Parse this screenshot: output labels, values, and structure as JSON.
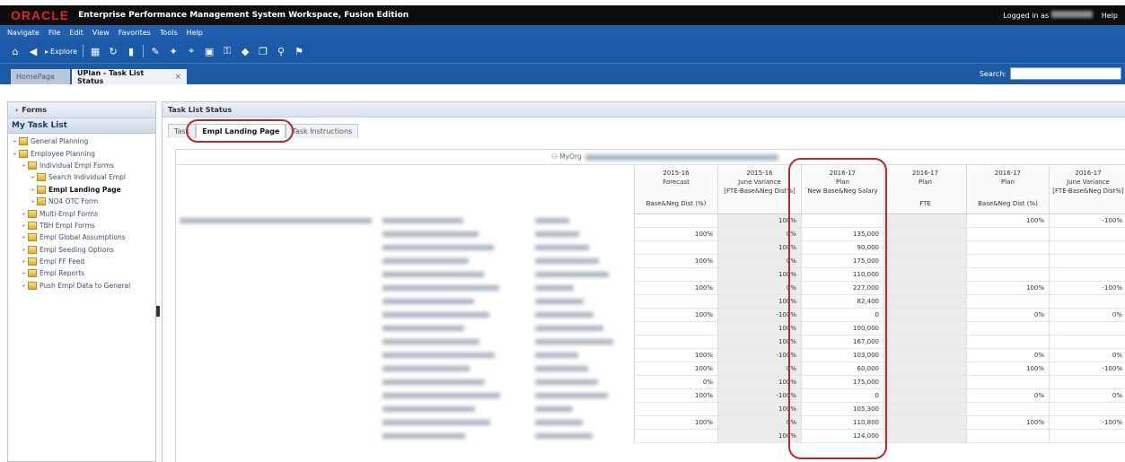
{
  "titlebar": {
    "logo": "ORACLE",
    "title": "Enterprise Performance Management System Workspace, Fusion Edition",
    "logged_in_label": "Logged in as",
    "help_label": "Help"
  },
  "menubar": {
    "items": [
      "Navigate",
      "File",
      "Edit",
      "View",
      "Favorites",
      "Tools",
      "Help"
    ]
  },
  "toolbar": {
    "explore_label": "Explore"
  },
  "tabs": {
    "home_label": "HomePage",
    "active_label": "UPlan - Task List Status",
    "close_glyph": "×"
  },
  "search": {
    "label": "Search:",
    "value": ""
  },
  "leftpanel": {
    "forms_label": "Forms",
    "task_list_label": "My Task List",
    "tree": [
      {
        "label": "General Planning",
        "indent": 0,
        "bold": false
      },
      {
        "label": "Employee Planning",
        "indent": 0,
        "bold": false
      },
      {
        "label": "Individual Empl Forms",
        "indent": 1,
        "bold": false
      },
      {
        "label": "Search Individual Empl",
        "indent": 2,
        "bold": false
      },
      {
        "label": "Empl Landing Page",
        "indent": 2,
        "bold": true
      },
      {
        "label": "NO4 OTC Form",
        "indent": 2,
        "bold": false
      },
      {
        "label": "Multi-Empl Forms",
        "indent": 1,
        "bold": false
      },
      {
        "label": "TBH Empl Forms",
        "indent": 1,
        "bold": false
      },
      {
        "label": "Empl Global Assumptions",
        "indent": 1,
        "bold": false
      },
      {
        "label": "Empl Seeding Options",
        "indent": 1,
        "bold": false
      },
      {
        "label": "Empl FF Feed",
        "indent": 1,
        "bold": false
      },
      {
        "label": "Empl Reports",
        "indent": 1,
        "bold": false
      },
      {
        "label": "Push Empl Data to General",
        "indent": 1,
        "bold": false
      }
    ]
  },
  "rightpanel": {
    "title": "Task List Status",
    "subtabs": [
      "Task",
      "Empl Landing Page",
      "Task Instructions"
    ],
    "pov_label": "MyOrg"
  },
  "grid": {
    "columns": [
      {
        "year": "2015-16",
        "scenario": "Forecast",
        "mid": "",
        "measure": "Base&Neg Dist (%)"
      },
      {
        "year": "2015-16",
        "scenario": "June Variance",
        "mid": "[FTE-Base&Neg Dist%]",
        "measure": ""
      },
      {
        "year": "2016-17",
        "scenario": "Plan",
        "mid": "New Base&Neg Salary",
        "measure": ""
      },
      {
        "year": "2016-17",
        "scenario": "Plan",
        "mid": "",
        "measure": "FTE"
      },
      {
        "year": "2016-17",
        "scenario": "Plan",
        "mid": "",
        "measure": "Base&Neg Dist (%)"
      },
      {
        "year": "2016-17",
        "scenario": "June Variance",
        "mid": "[FTE-Base&Neg Dist%]",
        "measure": ""
      }
    ],
    "rows": [
      [
        "",
        "100%",
        "",
        "",
        "100%",
        "-100%"
      ],
      [
        "100%",
        "0%",
        "135,000",
        "",
        "",
        ""
      ],
      [
        "",
        "100%",
        "90,000",
        "",
        "",
        ""
      ],
      [
        "100%",
        "0%",
        "175,000",
        "",
        "",
        ""
      ],
      [
        "",
        "100%",
        "110,000",
        "",
        "",
        ""
      ],
      [
        "100%",
        "0%",
        "227,000",
        "",
        "100%",
        "-100%"
      ],
      [
        "",
        "100%",
        "82,400",
        "",
        "",
        ""
      ],
      [
        "100%",
        "-100%",
        "0",
        "",
        "0%",
        "0%"
      ],
      [
        "",
        "100%",
        "100,000",
        "",
        "",
        ""
      ],
      [
        "",
        "100%",
        "167,000",
        "",
        "",
        ""
      ],
      [
        "100%",
        "-100%",
        "103,000",
        "",
        "0%",
        "0%"
      ],
      [
        "100%",
        "0%",
        "60,000",
        "",
        "100%",
        "-100%"
      ],
      [
        "0%",
        "100%",
        "175,000",
        "",
        "",
        ""
      ],
      [
        "100%",
        "-100%",
        "0",
        "",
        "0%",
        "0%"
      ],
      [
        "",
        "100%",
        "105,300",
        "",
        "",
        ""
      ],
      [
        "100%",
        "0%",
        "110,800",
        "",
        "100%",
        "-100%"
      ],
      [
        "",
        "100%",
        "124,000",
        "",
        "",
        ""
      ]
    ]
  }
}
